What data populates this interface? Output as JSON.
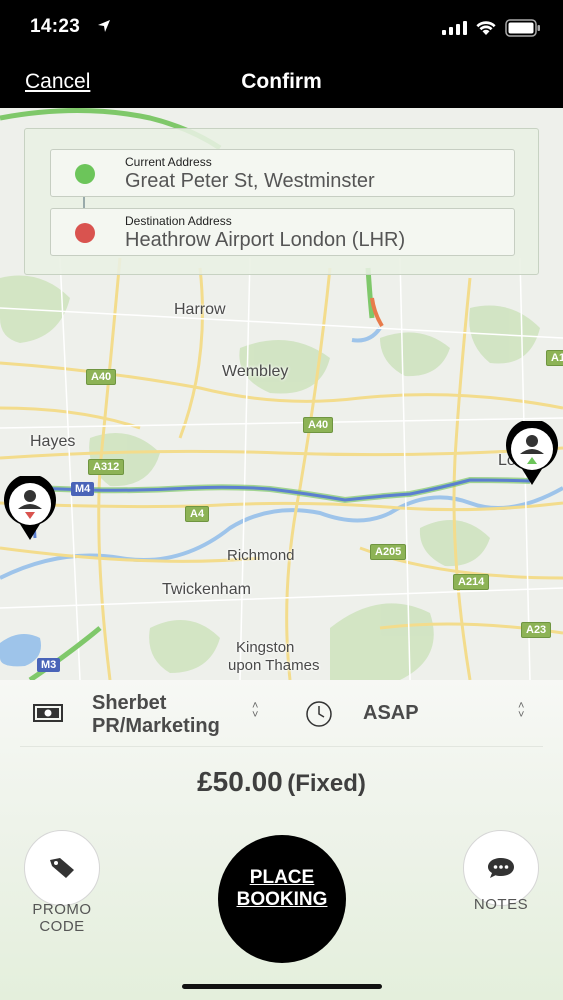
{
  "status": {
    "time": "14:23"
  },
  "nav": {
    "cancel_label": "Cancel",
    "title": "Confirm"
  },
  "addresses": {
    "current_label": "Current Address",
    "current_value": "Great Peter St, Westminster",
    "destination_label": "Destination Address",
    "destination_value": "Heathrow Airport London (LHR)",
    "current_dot_color": "#6cc55a",
    "destination_dot_color": "#d9534f"
  },
  "map": {
    "places": [
      "Harrow",
      "Wembley",
      "Hayes",
      "Richmond",
      "Twickenham",
      "Kingston",
      "upon Thames",
      "Lo"
    ],
    "road_shields": [
      "A40",
      "A40",
      "A312",
      "A4",
      "A205",
      "A214",
      "A23",
      "A1"
    ],
    "motorway_shields": [
      "M4",
      "M3"
    ],
    "route_color": "#5b7fd0"
  },
  "booking": {
    "account_line1": "Sherbet",
    "account_line2": "PR/Marketing",
    "pickup_time": "ASAP",
    "price": "£50.00",
    "price_note": "(Fixed)",
    "promo_line1": "PROMO",
    "promo_line2": "CODE",
    "place_line1": "PLACE",
    "place_line2": "BOOKING",
    "notes_label": "NOTES"
  }
}
